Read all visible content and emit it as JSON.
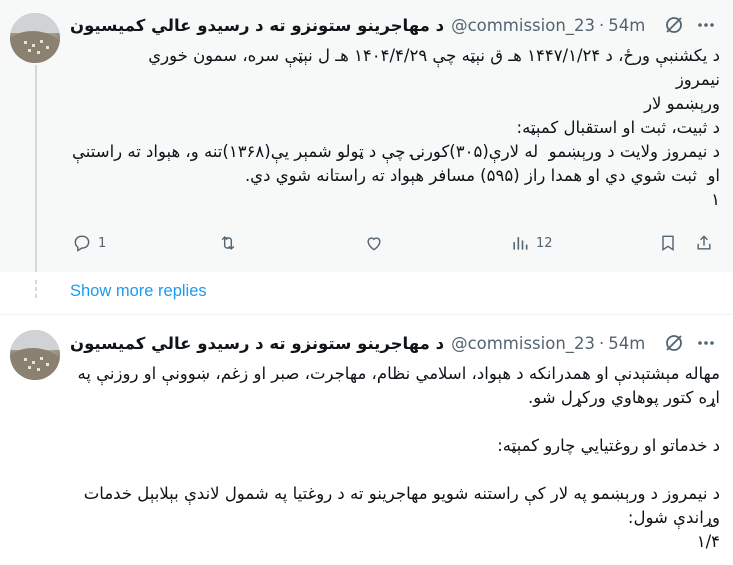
{
  "tweets": [
    {
      "name": "د مهاجرينو ستونزو ته د رسيدو عالي کميسيون",
      "handle": "@commission_23",
      "separator": "·",
      "time": "54m",
      "text": "د يکشنبې ورځ، د ۱۴۴۷/۱/۲۴ هـ ق نېټه چې ۱۴۰۴/۴/۲۹ هـ ل نېټې سره، سمون خوري\nنيمروز\nورېښمو لار\nد ثبيت، ثبت او استقبال کمېټه:\nد نيمروز ولايت د ورېښمو  له لارې(۳۰۵)کورنۍ چې د ټولو شمېر يې(۱۳۶۸)تنه و، هېواد ته راستنې او  ثبت شوي دي او همدا راز (۵۹۵) مسافر هېواد ته راستانه شوي دي.\n۱",
      "replies": "1",
      "views": "12"
    },
    {
      "name": "د مهاجرينو ستونزو ته د رسيدو عالي کميسيون",
      "handle": "@commission_23",
      "separator": "·",
      "time": "54m",
      "text": "مهاله مېشتېدنې او همدرانکه د هېواد، اسلامي نظام، مهاجرت، صبر او زغم، ښوونې او روزنې په اړه کتور پوهاوي ورکړل شو.\n\nد خدماتو او روغتيايي چارو کمېټه:\n\nد نيمروز د ورېښمو په لار کې راستنه شويو مهاجرينو ته د روغتيا په شمول لاندې بېلابېل خدمات وړاندې شول:\n۱/۴"
    }
  ],
  "show_more_label": "Show more replies",
  "colors": {
    "link": "#1d9bf0",
    "muted": "#536471",
    "thread_line": "#cfd9de"
  },
  "icons": [
    "grok-icon",
    "more-icon",
    "reply-icon",
    "retweet-icon",
    "like-icon",
    "views-icon",
    "bookmark-icon",
    "share-icon"
  ]
}
